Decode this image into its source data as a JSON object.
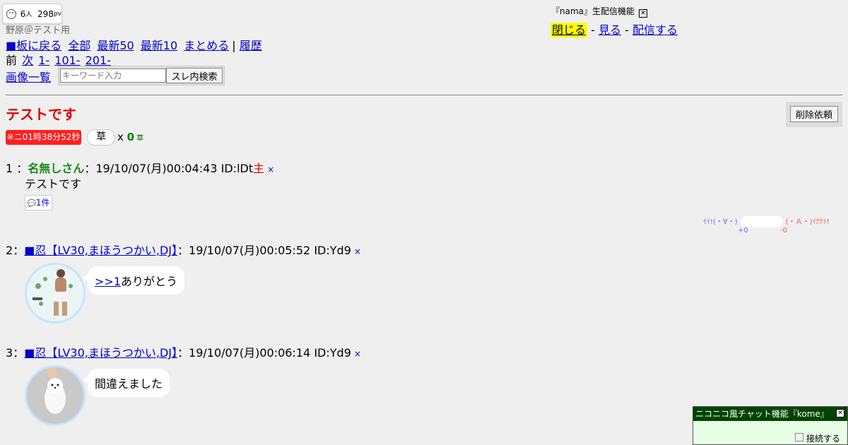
{
  "viewer": {
    "count": "6",
    "unit": "人",
    "pv": "298",
    "pv_unit": "pv",
    "icon": "face-icon"
  },
  "board_name": "野原＠テスト用",
  "nav": {
    "back_board": "■板に戻る",
    "all": "全部",
    "latest50": "最新50",
    "latest10": "最新10",
    "summary": "まとめる",
    "sep": "|",
    "history": "履歴",
    "prev": "前",
    "next": "次",
    "range1": "1-",
    "range2": "101-",
    "range3": "201-",
    "images": "画像一覧"
  },
  "search": {
    "placeholder": "キーワード入力",
    "button": "スレ内検索"
  },
  "nama": {
    "title": "『nama』生配信機能",
    "close": "閉じる",
    "dash1": "-",
    "watch": "見る",
    "dash2": "-",
    "broadcast": "配信する",
    "checkbox_icon": "close-box-icon"
  },
  "thread": {
    "title": "テストです",
    "delete_button": "削除依頼",
    "timer": "※ニ01時38分52秒",
    "kusa_label": "草",
    "kusa_x": "x",
    "kusa_count": "0",
    "kusa_unit": "草"
  },
  "posts": [
    {
      "num": "1",
      "sep": "：",
      "name": "名無しさん",
      "colon": "：",
      "date": "19/10/07(月)00:04:43",
      "id": "ID:lDt",
      "owner": "主",
      "x": "×",
      "body": "テストです",
      "reply_count": "1件"
    },
    {
      "num": "2",
      "sep": "：",
      "name": "■忍【LV30,まほうつかい,DJ】",
      "colon": "：",
      "date": "19/10/07(月)00:05:52",
      "id": "ID:Yd9",
      "x": "×",
      "anchor": ">>1",
      "body": "ありがとう"
    },
    {
      "num": "3",
      "sep": "：",
      "name": "■忍【LV30,まほうつかい,DJ】",
      "colon": "：",
      "date": "19/10/07(月)00:06:14",
      "id": "ID:Yd9",
      "x": "×",
      "body": "間違えました"
    }
  ],
  "votes": {
    "good_label": "ｲｲ!(・∀・)",
    "bad_label": "(・Ａ・)ｲｸﾅｲ!",
    "good_count": "+0",
    "bad_count": "-0",
    "good_color": "#6b6bff",
    "bad_color": "#ff5555"
  },
  "kome": {
    "title": "ニコニコ風チャット機能『kome』",
    "connect": "接続する"
  },
  "colors": {
    "title_red": "#e00000",
    "name_green": "#1a8a1a",
    "link_blue": "#0000cc",
    "timer_red": "#ff2020",
    "kome_header": "#004400"
  }
}
